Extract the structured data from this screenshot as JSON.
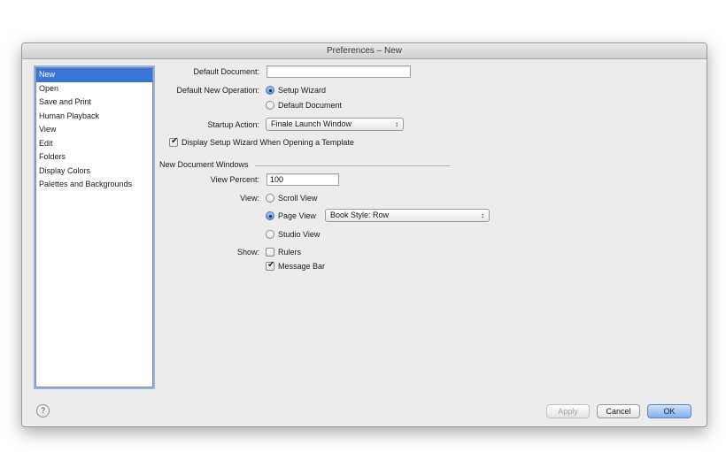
{
  "window": {
    "title": "Preferences – New"
  },
  "sidebar": {
    "items": [
      {
        "label": "New",
        "selected": true
      },
      {
        "label": "Open"
      },
      {
        "label": "Save and Print"
      },
      {
        "label": "Human Playback"
      },
      {
        "label": "View"
      },
      {
        "label": "Edit"
      },
      {
        "label": "Folders"
      },
      {
        "label": "Display Colors"
      },
      {
        "label": "Palettes and Backgrounds"
      }
    ]
  },
  "form": {
    "default_document_label": "Default Document:",
    "default_document_value": "",
    "default_new_operation_label": "Default New Operation:",
    "op_setup_wizard": "Setup Wizard",
    "op_default_document": "Default Document",
    "startup_action_label": "Startup Action:",
    "startup_action_value": "Finale Launch Window",
    "display_wizard_label": "Display Setup Wizard When Opening a Template",
    "new_doc_windows_heading": "New Document Windows",
    "view_percent_label": "View Percent:",
    "view_percent_value": "100",
    "view_label": "View:",
    "view_scroll": "Scroll View",
    "view_page": "Page View",
    "page_style_value": "Book Style: Row",
    "view_studio": "Studio View",
    "show_label": "Show:",
    "show_rulers": "Rulers",
    "show_message_bar": "Message Bar"
  },
  "footer": {
    "help": "?",
    "apply": "Apply",
    "cancel": "Cancel",
    "ok": "OK"
  },
  "icons": {
    "popup_arrows": "↕",
    "colors": {
      "selection": "#3875d7",
      "default_button": "#7fb0ec"
    }
  }
}
